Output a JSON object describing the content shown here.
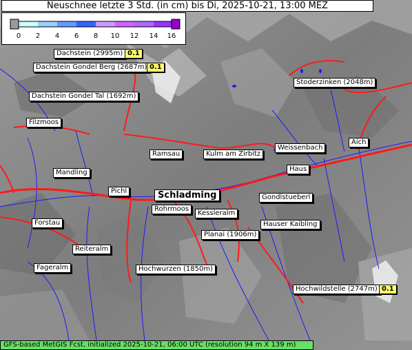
{
  "title": "Neuschnee letzte 3 Std. (in cm) bis Di, 2025-10-21, 13:00 MEZ",
  "legend": {
    "ticks": [
      "0",
      "2",
      "4",
      "6",
      "8",
      "10",
      "12",
      "14",
      "16"
    ],
    "colors": [
      "#cccccc",
      "#ccffff",
      "#99ccff",
      "#6699ff",
      "#3366ff",
      "#cc99ff",
      "#cc66ff",
      "#9933ff",
      "#9900cc"
    ]
  },
  "places": [
    {
      "name": "Dachstein (2995m)",
      "value": "0.1"
    },
    {
      "name": "Dachstein Gondel Berg (2687m)",
      "value": "0.1"
    },
    {
      "name": "Dachstein Gondel Tal (1692m)"
    },
    {
      "name": "Stoderzinken (2048m)"
    },
    {
      "name": "Filzmoos"
    },
    {
      "name": "Weissenbach"
    },
    {
      "name": "Aich"
    },
    {
      "name": "Ramsau"
    },
    {
      "name": "Kulm am Zirbitz"
    },
    {
      "name": "Mandling"
    },
    {
      "name": "Haus"
    },
    {
      "name": "Pichl"
    },
    {
      "name": "Schladming"
    },
    {
      "name": "Gondlstueberl"
    },
    {
      "name": "Rohrmoos"
    },
    {
      "name": "Kessleralm"
    },
    {
      "name": "Forstau"
    },
    {
      "name": "Hauser Kaibling"
    },
    {
      "name": "Planai (1906m)"
    },
    {
      "name": "Reiteralm"
    },
    {
      "name": "Fageralm"
    },
    {
      "name": "Hochwurzen (1850m)"
    },
    {
      "name": "Hochwildstelle (2747m)",
      "value": "0.1"
    }
  ],
  "footer": "GFS-based MetGIS Fcst, initialized 2025-10-21, 06:00 UTC  (resolution 94 m X 139 m)"
}
